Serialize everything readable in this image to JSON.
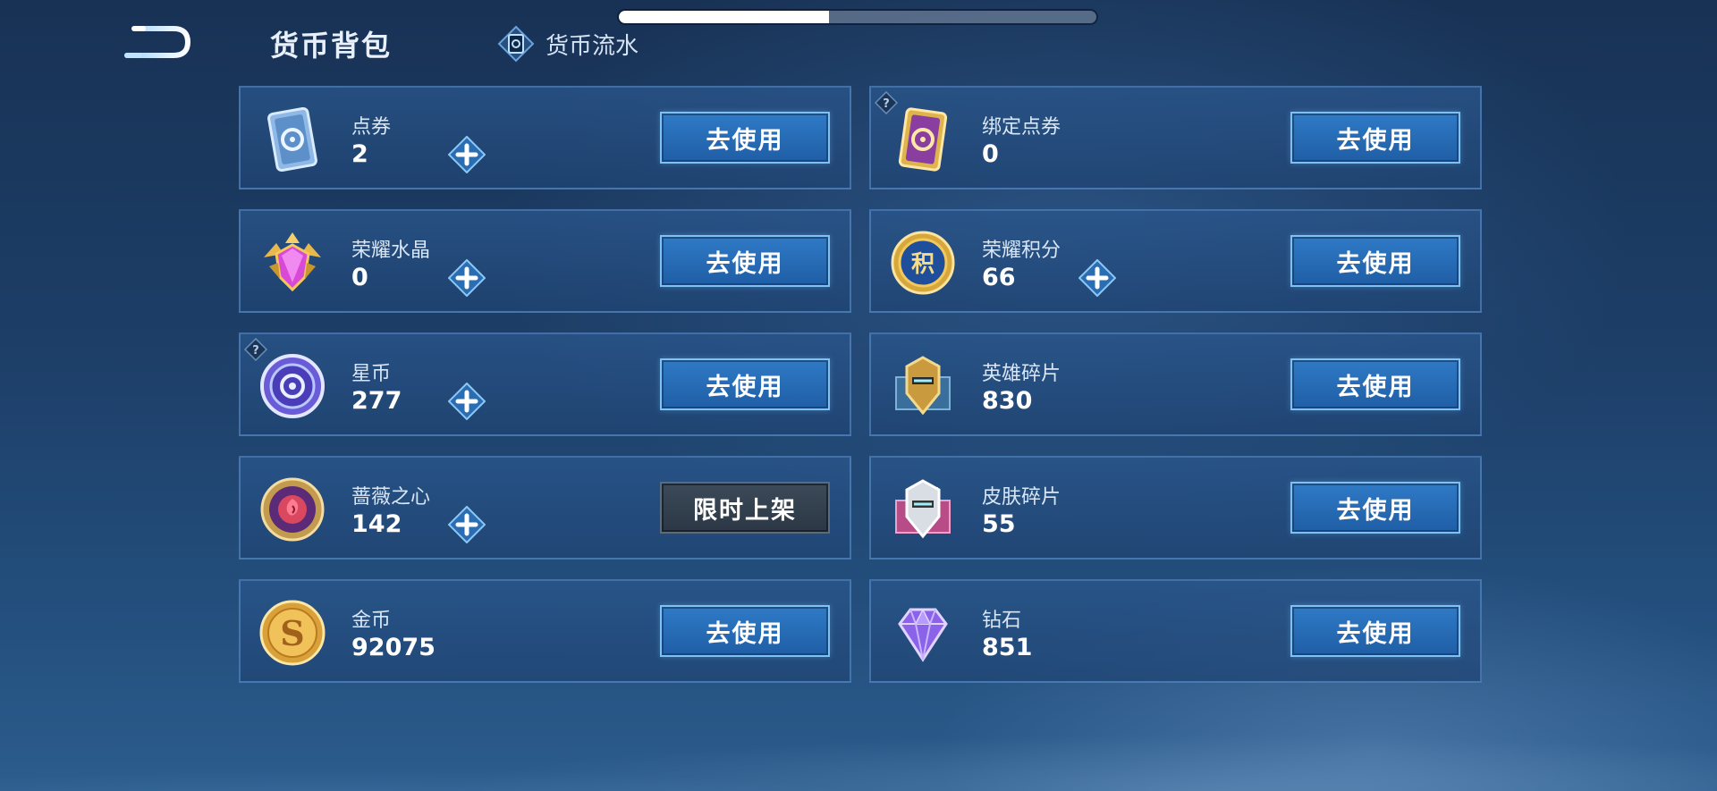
{
  "top_progress": 0.44,
  "header": {
    "title": "货币背包",
    "flow_label": "货币流水"
  },
  "colors": {
    "button_blue": "#2f7ac6",
    "button_grey": "#3c4a59",
    "card_border": "#5f96d2"
  },
  "currencies": [
    {
      "name": "点券",
      "amount": "2",
      "icon": "voucher-card-icon",
      "has_plus": true,
      "button": "去使用"
    },
    {
      "name": "绑定点券",
      "amount": "0",
      "icon": "bound-voucher-card-icon",
      "has_plus": false,
      "button": "去使用",
      "help": true
    },
    {
      "name": "荣耀水晶",
      "amount": "0",
      "icon": "glory-crystal-icon",
      "has_plus": true,
      "button": "去使用"
    },
    {
      "name": "荣耀积分",
      "amount": "66",
      "icon": "glory-points-icon",
      "has_plus": true,
      "button": "去使用"
    },
    {
      "name": "星币",
      "amount": "277",
      "icon": "star-coin-icon",
      "has_plus": true,
      "button": "去使用",
      "help": true
    },
    {
      "name": "英雄碎片",
      "amount": "830",
      "icon": "hero-fragment-icon",
      "has_plus": false,
      "button": "去使用"
    },
    {
      "name": "蔷薇之心",
      "amount": "142",
      "icon": "rose-heart-icon",
      "has_plus": true,
      "button": "限时上架",
      "disabled": true
    },
    {
      "name": "皮肤碎片",
      "amount": "55",
      "icon": "skin-fragment-icon",
      "has_plus": false,
      "button": "去使用"
    },
    {
      "name": "金币",
      "amount": "92075",
      "icon": "gold-coin-icon",
      "has_plus": false,
      "button": "去使用"
    },
    {
      "name": "钻石",
      "amount": "851",
      "icon": "diamond-icon",
      "has_plus": false,
      "button": "去使用"
    }
  ]
}
